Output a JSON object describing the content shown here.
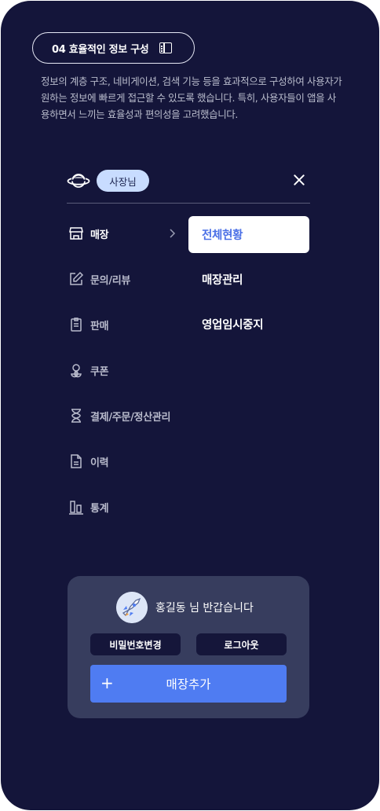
{
  "header": {
    "section_label": "04  효율적인 정보 구성",
    "book_icon": "book-open-icon",
    "description": "정보의 계층 구조, 네비게이션, 검색 기능 등을 효과적으로 구성하여 사용자가 원하는 정보에 빠르게 접근할 수 있도록 했습니다. 특히, 사용자들이 앱을 사용하면서 느끼는 효율성과 편의성을 고려했습니다."
  },
  "menu": {
    "logo_icon": "planet-icon",
    "role_badge": "사장님",
    "close_icon": "close-icon",
    "nav": [
      {
        "label": "매장",
        "icon": "store-icon",
        "active": true
      },
      {
        "label": "문의/리뷰",
        "icon": "edit-icon"
      },
      {
        "label": "판매",
        "icon": "clipboard-icon"
      },
      {
        "label": "쿠폰",
        "icon": "clover-icon"
      },
      {
        "label": "결제/주문/정산관리",
        "icon": "hourglass-icon"
      },
      {
        "label": "이력",
        "icon": "document-icon"
      },
      {
        "label": "통계",
        "icon": "bar-chart-icon"
      }
    ],
    "submenu": [
      {
        "label": "전체현황",
        "selected": true
      },
      {
        "label": "매장관리"
      },
      {
        "label": "영업임시중지"
      }
    ]
  },
  "user_panel": {
    "greeting": "홍길동 님 반갑습니다",
    "change_password": "비밀번호변경",
    "logout": "로그아웃",
    "add_store_plus": "+",
    "add_store": "매장추가"
  },
  "colors": {
    "background": "#14153a",
    "accent": "#4f7cf2",
    "badge": "#c8dcff",
    "panel": "#373d5e"
  }
}
